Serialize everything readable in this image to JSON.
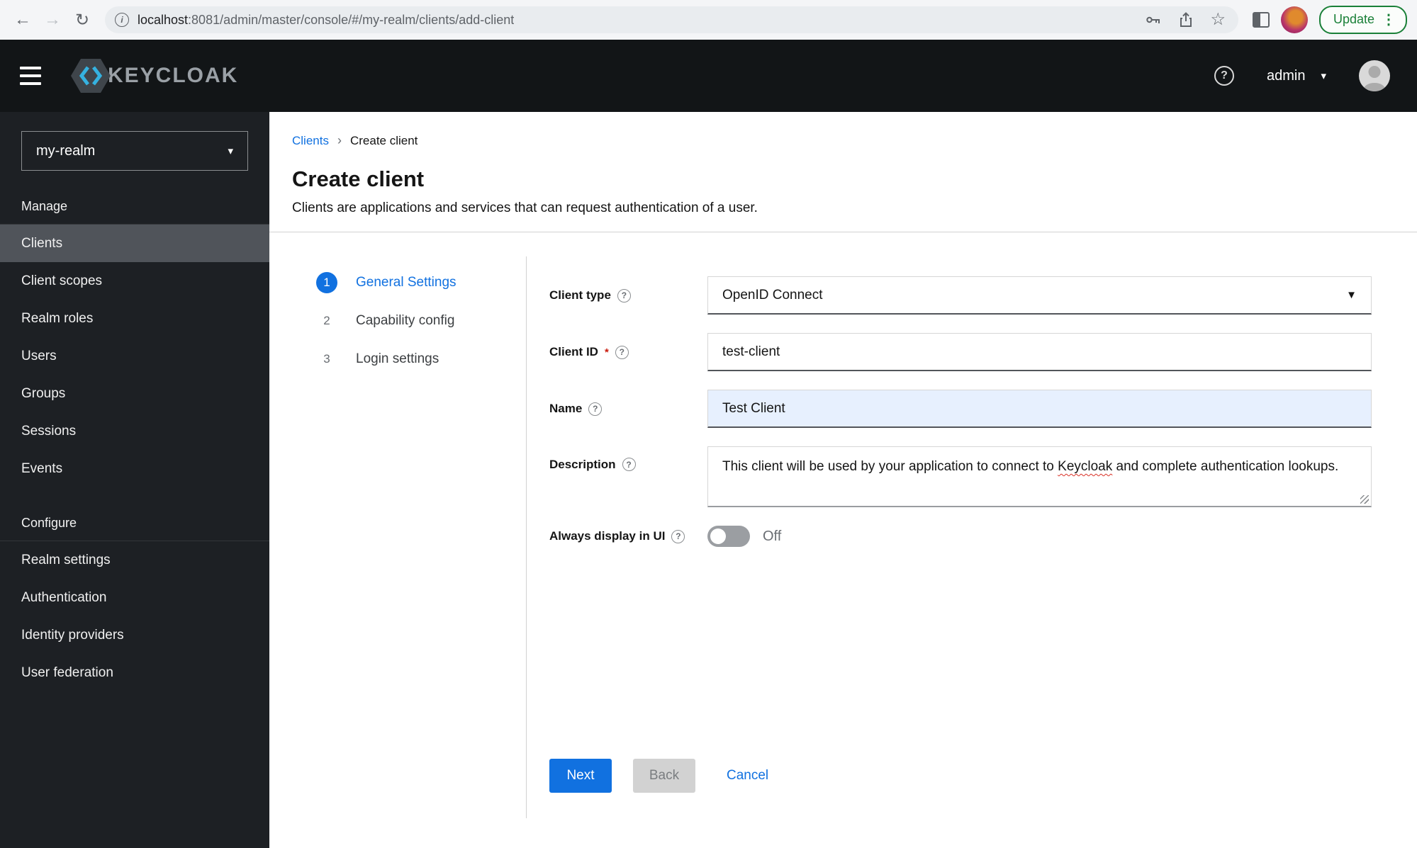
{
  "icons": {
    "question": "?",
    "info": "i",
    "caret_down": "▾",
    "select_caret": "▼",
    "chevron_right": "›",
    "star": "☆",
    "dots": "⋮",
    "back": "←",
    "forward": "→",
    "reload": "↻"
  },
  "browser": {
    "url_host": "localhost",
    "url_path": ":8081/admin/master/console/#/my-realm/clients/add-client",
    "update_label": "Update"
  },
  "header": {
    "brand": "KEYCLOAK",
    "username": "admin"
  },
  "sidebar": {
    "realm": "my-realm",
    "sections": [
      {
        "label": "Manage",
        "items": [
          {
            "label": "Clients"
          },
          {
            "label": "Client scopes"
          },
          {
            "label": "Realm roles"
          },
          {
            "label": "Users"
          },
          {
            "label": "Groups"
          },
          {
            "label": "Sessions"
          },
          {
            "label": "Events"
          }
        ]
      },
      {
        "label": "Configure",
        "items": [
          {
            "label": "Realm settings"
          },
          {
            "label": "Authentication"
          },
          {
            "label": "Identity providers"
          },
          {
            "label": "User federation"
          }
        ]
      }
    ]
  },
  "breadcrumb": {
    "parent": "Clients",
    "current": "Create client"
  },
  "page": {
    "title": "Create client",
    "subtitle": "Clients are applications and services that can request authentication of a user."
  },
  "wizard": {
    "steps": [
      {
        "num": "1",
        "label": "General Settings"
      },
      {
        "num": "2",
        "label": "Capability config"
      },
      {
        "num": "3",
        "label": "Login settings"
      }
    ]
  },
  "form": {
    "client_type": {
      "label": "Client type",
      "value": "OpenID Connect"
    },
    "client_id": {
      "label": "Client ID",
      "required_mark": "*",
      "value": "test-client"
    },
    "name": {
      "label": "Name",
      "value": "Test Client"
    },
    "description": {
      "label": "Description",
      "value_part1": "This client will be used by your application to connect to ",
      "value_word": "Keycloak",
      "value_part2": " and complete authentication lookups."
    },
    "always_display": {
      "label": "Always display in UI",
      "state": "Off"
    }
  },
  "actions": {
    "next": "Next",
    "back": "Back",
    "cancel": "Cancel"
  },
  "colors": {
    "accent": "#1171e0",
    "header_bg": "#121517",
    "sidebar_bg": "#1d2024",
    "selected_bg": "#50545a",
    "autofill_bg": "#e7f0fe",
    "update_green": "#1a8038",
    "required_red": "#c9190b"
  }
}
